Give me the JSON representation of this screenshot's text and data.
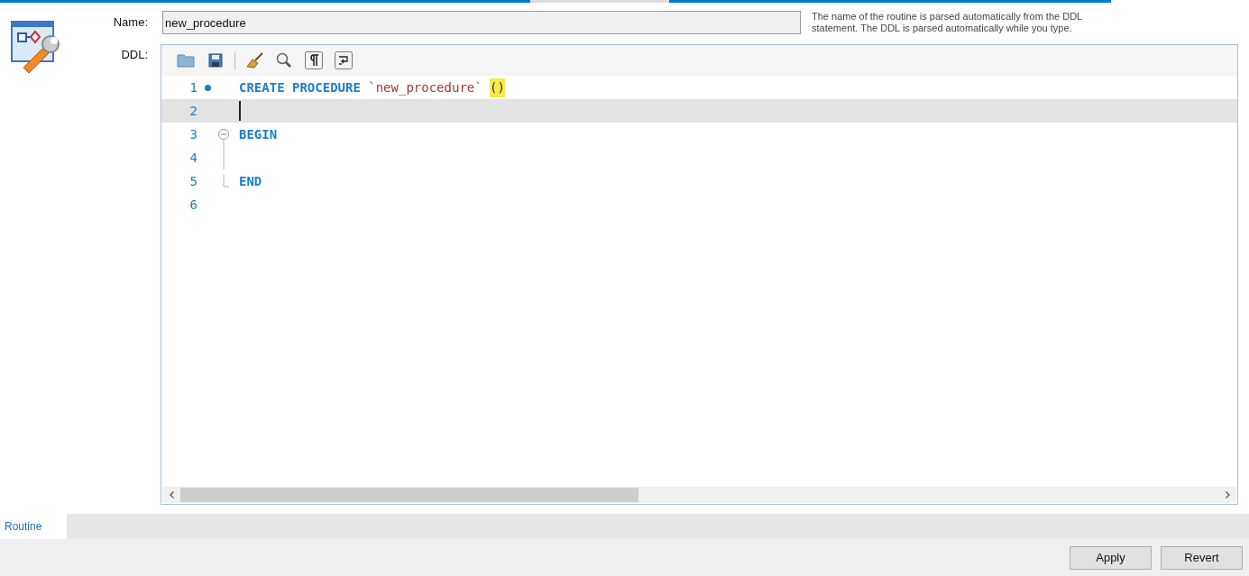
{
  "form": {
    "name_label": "Name:",
    "name_value": "new_procedure",
    "hint": "The name of the routine is parsed automatically from the DDL statement. The DDL is parsed automatically while you type.",
    "ddl_label": "DDL:"
  },
  "editor": {
    "lines": [
      {
        "number": "1",
        "bookmark": true,
        "current": false,
        "fold_start": false,
        "fold_continue": false,
        "fold_end": false,
        "tokens": [
          {
            "kind": "keyword",
            "text": "CREATE PROCEDURE"
          },
          {
            "kind": "identifier",
            "text": "`new_procedure`"
          },
          {
            "kind": "match",
            "text": "()"
          }
        ]
      },
      {
        "number": "2",
        "bookmark": false,
        "current": true,
        "fold_start": false,
        "fold_continue": false,
        "fold_end": false
      },
      {
        "number": "3",
        "bookmark": false,
        "current": false,
        "fold_start": true,
        "fold_continue": false,
        "fold_end": false,
        "tokens": [
          {
            "kind": "keyword",
            "text": "BEGIN"
          }
        ]
      },
      {
        "number": "4",
        "bookmark": false,
        "current": false,
        "fold_start": false,
        "fold_continue": true,
        "fold_end": false
      },
      {
        "number": "5",
        "bookmark": false,
        "current": false,
        "fold_start": false,
        "fold_continue": false,
        "fold_end": true,
        "tokens": [
          {
            "kind": "keyword",
            "text": "END"
          }
        ]
      },
      {
        "number": "6",
        "bookmark": false,
        "current": false,
        "fold_start": false,
        "fold_continue": false,
        "fold_end": false
      }
    ]
  },
  "tabs": [
    {
      "label": "Routine",
      "selected": true
    }
  ],
  "buttons": [
    "Apply",
    "Revert"
  ]
}
